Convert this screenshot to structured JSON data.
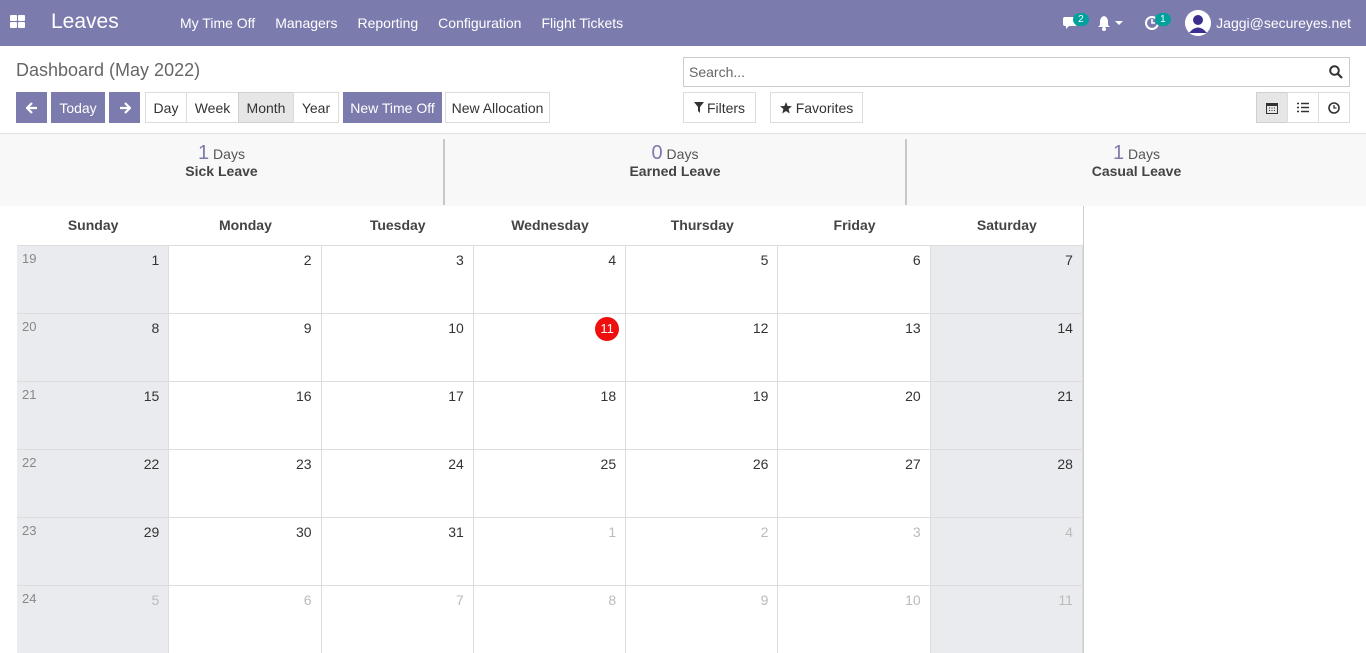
{
  "navbar": {
    "brand": "Leaves",
    "menu": [
      "My Time Off",
      "Managers",
      "Reporting",
      "Configuration",
      "Flight Tickets"
    ],
    "messages_count": "2",
    "activities_count": "1",
    "user": "Jaggi@secureyes.net"
  },
  "control": {
    "title": "Dashboard (May 2022)",
    "today": "Today",
    "day": "Day",
    "week": "Week",
    "month": "Month",
    "year": "Year",
    "new_time_off": "New Time Off",
    "new_allocation": "New Allocation",
    "search_placeholder": "Search...",
    "filters": "Filters",
    "favorites": "Favorites"
  },
  "summary": [
    {
      "count": "1",
      "unit": "Days",
      "label": "Sick Leave"
    },
    {
      "count": "0",
      "unit": "Days",
      "label": "Earned Leave"
    },
    {
      "count": "1",
      "unit": "Days",
      "label": "Casual Leave"
    }
  ],
  "calendar": {
    "weekdays": [
      "Sunday",
      "Monday",
      "Tuesday",
      "Wednesday",
      "Thursday",
      "Friday",
      "Saturday"
    ],
    "today": 11,
    "weeks": [
      {
        "week": "19",
        "days": [
          1,
          2,
          3,
          4,
          5,
          6,
          7
        ]
      },
      {
        "week": "20",
        "days": [
          8,
          9,
          10,
          11,
          12,
          13,
          14
        ]
      },
      {
        "week": "21",
        "days": [
          15,
          16,
          17,
          18,
          19,
          20,
          21
        ]
      },
      {
        "week": "22",
        "days": [
          22,
          23,
          24,
          25,
          26,
          27,
          28
        ]
      },
      {
        "week": "23",
        "days": [
          29,
          30,
          31,
          1,
          2,
          3,
          4
        ]
      },
      {
        "week": "24",
        "days": [
          5,
          6,
          7,
          8,
          9,
          10,
          11
        ]
      }
    ]
  },
  "colors": {
    "navbar": "#7c7bad",
    "today_marker": "#f00f0f",
    "weekend": "#e9ebee"
  }
}
